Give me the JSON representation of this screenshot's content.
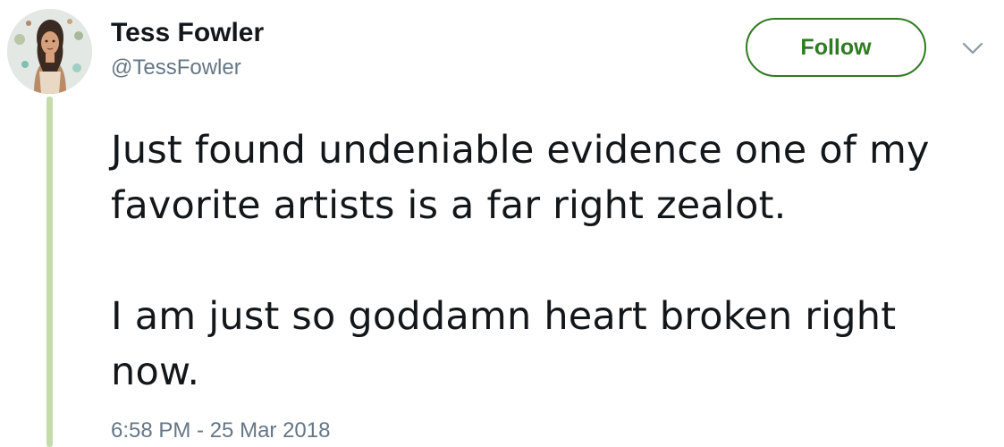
{
  "author": {
    "display_name": "Tess Fowler",
    "handle": "@TessFowler",
    "avatar_icon": "profile-avatar-illustration"
  },
  "actions": {
    "follow_label": "Follow",
    "menu_icon": "chevron-down-icon"
  },
  "tweet": {
    "paragraphs": [
      "Just found undeniable evidence one of my favorite artists is a far right zealot.",
      "I am just so goddamn heart broken right now."
    ],
    "timestamp": "6:58 PM - 25 Mar 2018"
  },
  "colors": {
    "follow_accent": "#2f7a22",
    "thread_line": "#c5dcaa",
    "secondary_text": "#657786",
    "primary_text": "#14171a"
  }
}
